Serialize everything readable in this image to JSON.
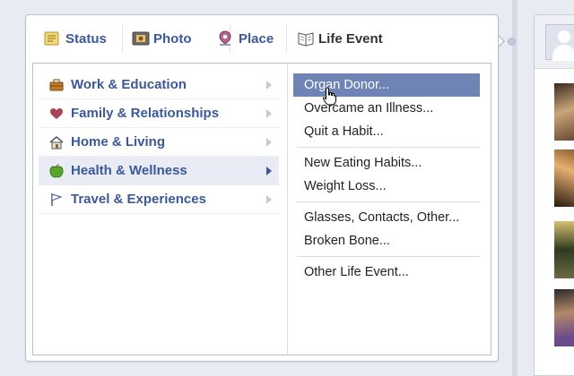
{
  "tabs": [
    {
      "label": "Status",
      "icon": "status-icon"
    },
    {
      "label": "Photo",
      "icon": "photo-icon"
    },
    {
      "label": "Place",
      "icon": "place-icon"
    },
    {
      "label": "Life Event",
      "icon": "life-event-icon"
    }
  ],
  "categories": [
    {
      "label": "Work & Education",
      "icon": "briefcase-icon"
    },
    {
      "label": "Family & Relationships",
      "icon": "heart-icon"
    },
    {
      "label": "Home & Living",
      "icon": "house-icon"
    },
    {
      "label": "Health & Wellness",
      "icon": "apple-icon"
    },
    {
      "label": "Travel & Experiences",
      "icon": "flag-icon"
    }
  ],
  "selected_category": "Health & Wellness",
  "submenu": {
    "group1": [
      "Organ Donor...",
      "Overcame an Illness...",
      "Quit a Habit..."
    ],
    "group2": [
      "New Eating Habits...",
      "Weight Loss..."
    ],
    "group3": [
      "Glasses, Contacts, Other...",
      "Broken Bone..."
    ],
    "group4": [
      "Other Life Event..."
    ]
  },
  "hovered_item": "Organ Donor...",
  "colors": {
    "link_blue": "#3b5998",
    "hover_bg": "#6d84b4",
    "selected_bg": "#e9ecf5"
  }
}
